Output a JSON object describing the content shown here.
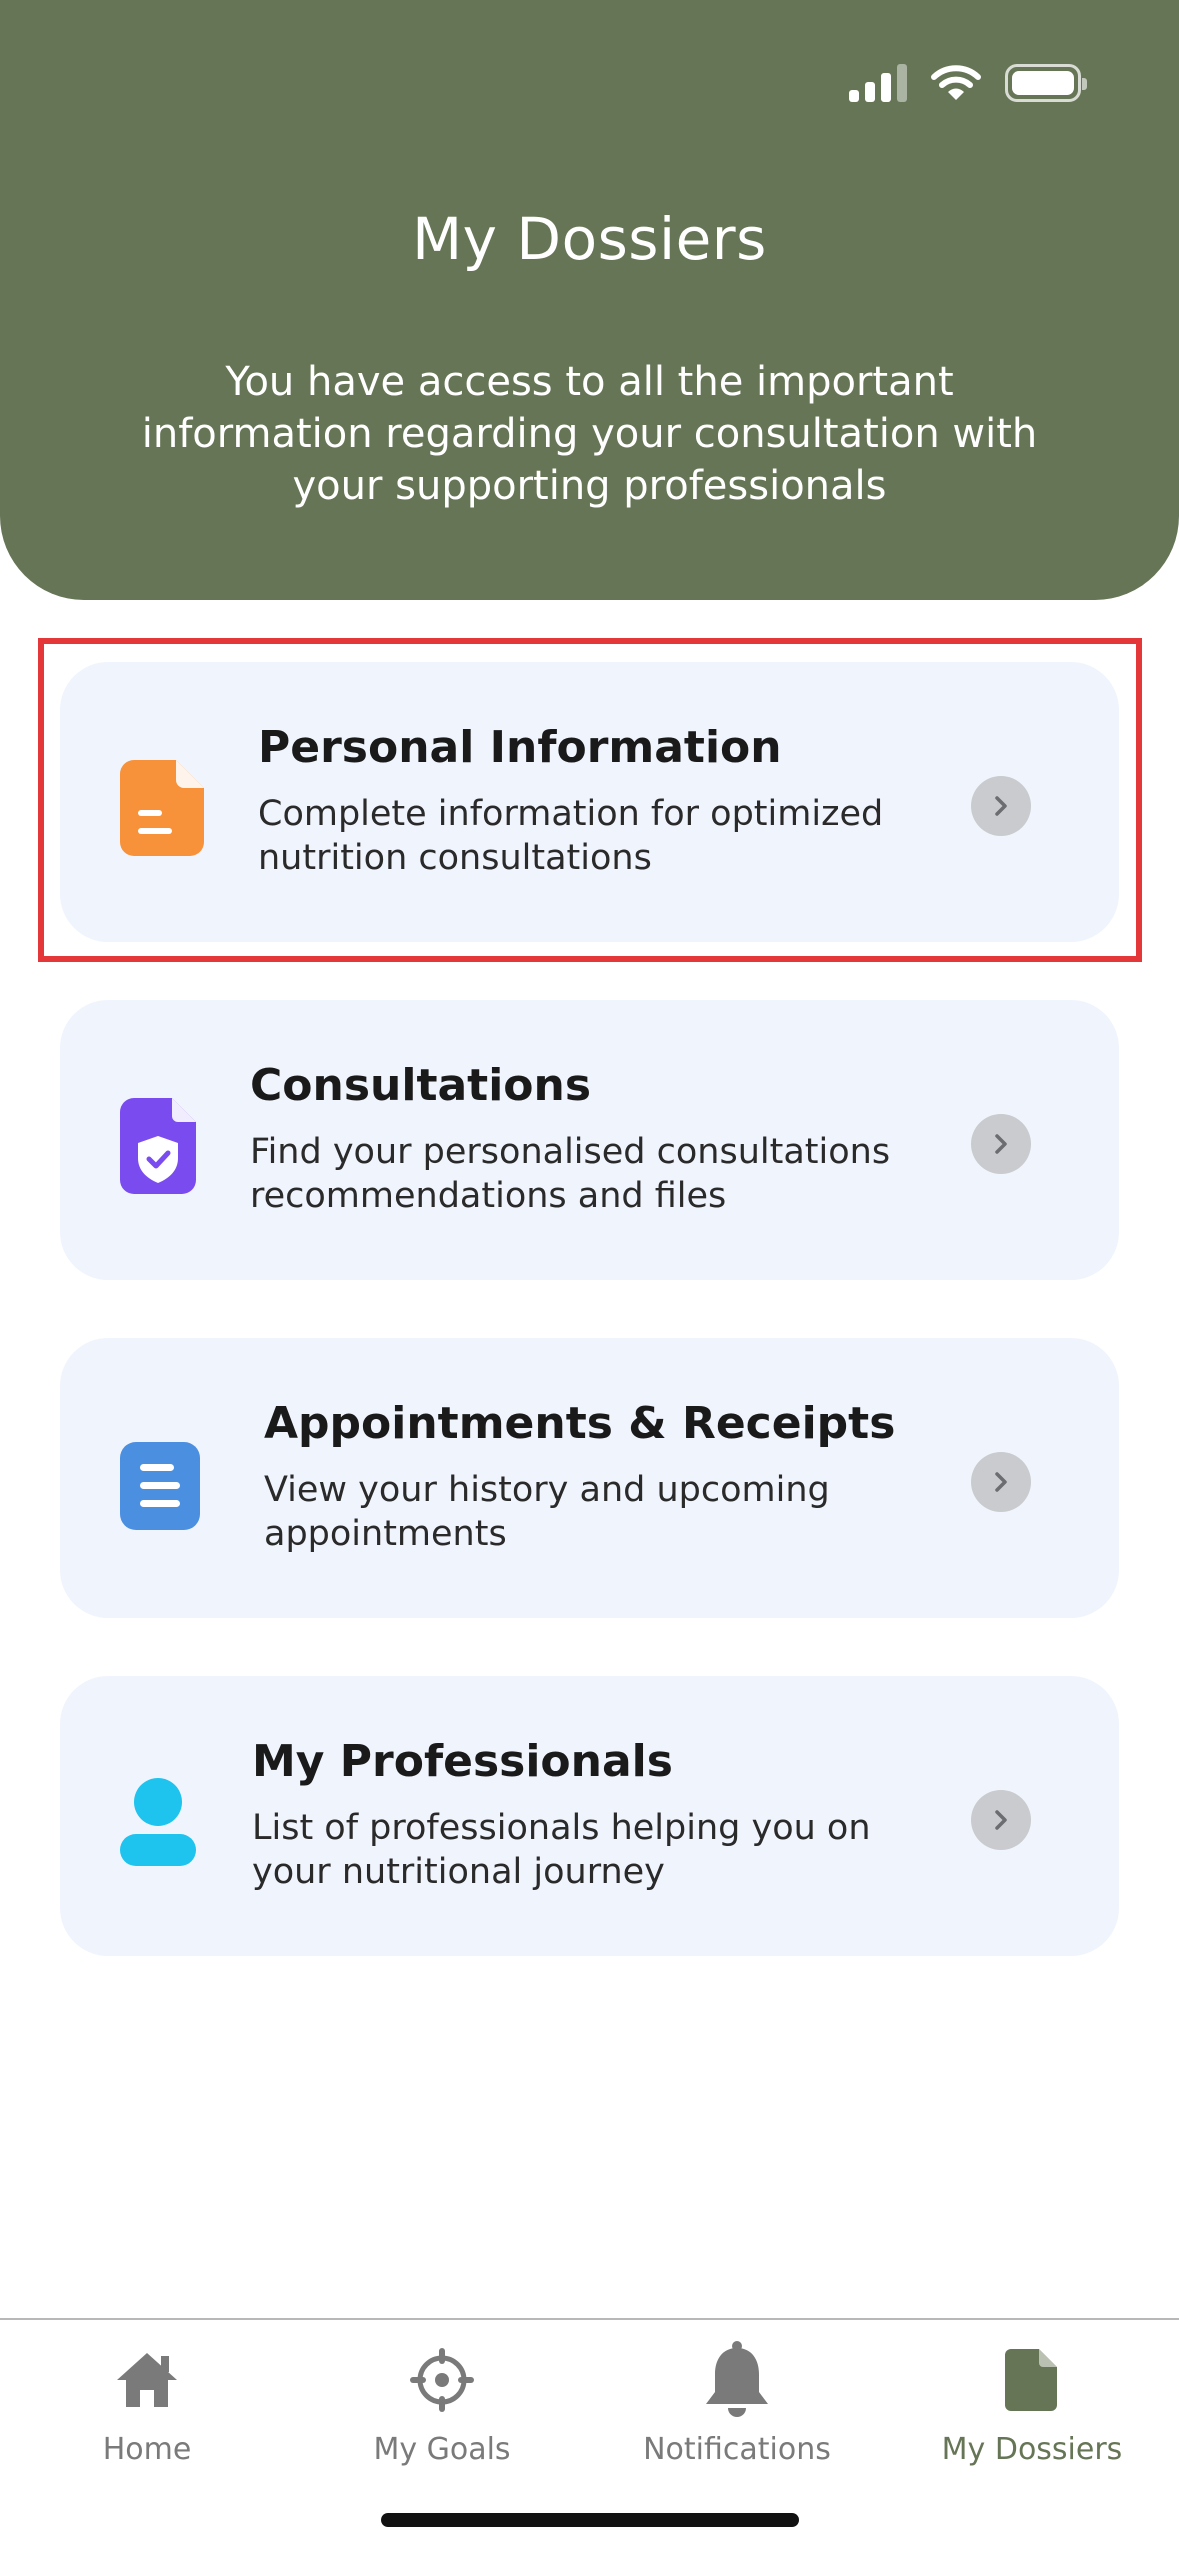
{
  "header": {
    "title": "My Dossiers",
    "subtitle": "You have access to all the important information regarding your consultation with your supporting professionals"
  },
  "cards": [
    {
      "title": "Personal Information",
      "description": "Complete information for optimized nutrition consultations",
      "icon": "document-icon",
      "color": "#f7913a"
    },
    {
      "title": "Consultations",
      "description": "Find your personalised consultations recommendations and files",
      "icon": "shield-document-icon",
      "color": "#7a4cf0"
    },
    {
      "title": "Appointments & Receipts",
      "description": "View your history and upcoming appointments",
      "icon": "list-document-icon",
      "color": "#4b8fe0"
    },
    {
      "title": "My Professionals",
      "description": "List of professionals helping you on your nutritional journey",
      "icon": "person-icon",
      "color": "#1ec3ee"
    }
  ],
  "tabs": [
    {
      "label": "Home",
      "icon": "home-icon",
      "active": false
    },
    {
      "label": "My Goals",
      "icon": "target-icon",
      "active": false
    },
    {
      "label": "Notifications",
      "icon": "bell-icon",
      "active": false
    },
    {
      "label": "My Dossiers",
      "icon": "file-icon",
      "active": true
    }
  ],
  "colors": {
    "header": "#667556",
    "card_background": "#f0f4fd",
    "highlight": "#e3373a",
    "tab_inactive": "#7a7a7a",
    "tab_active": "#667556"
  }
}
